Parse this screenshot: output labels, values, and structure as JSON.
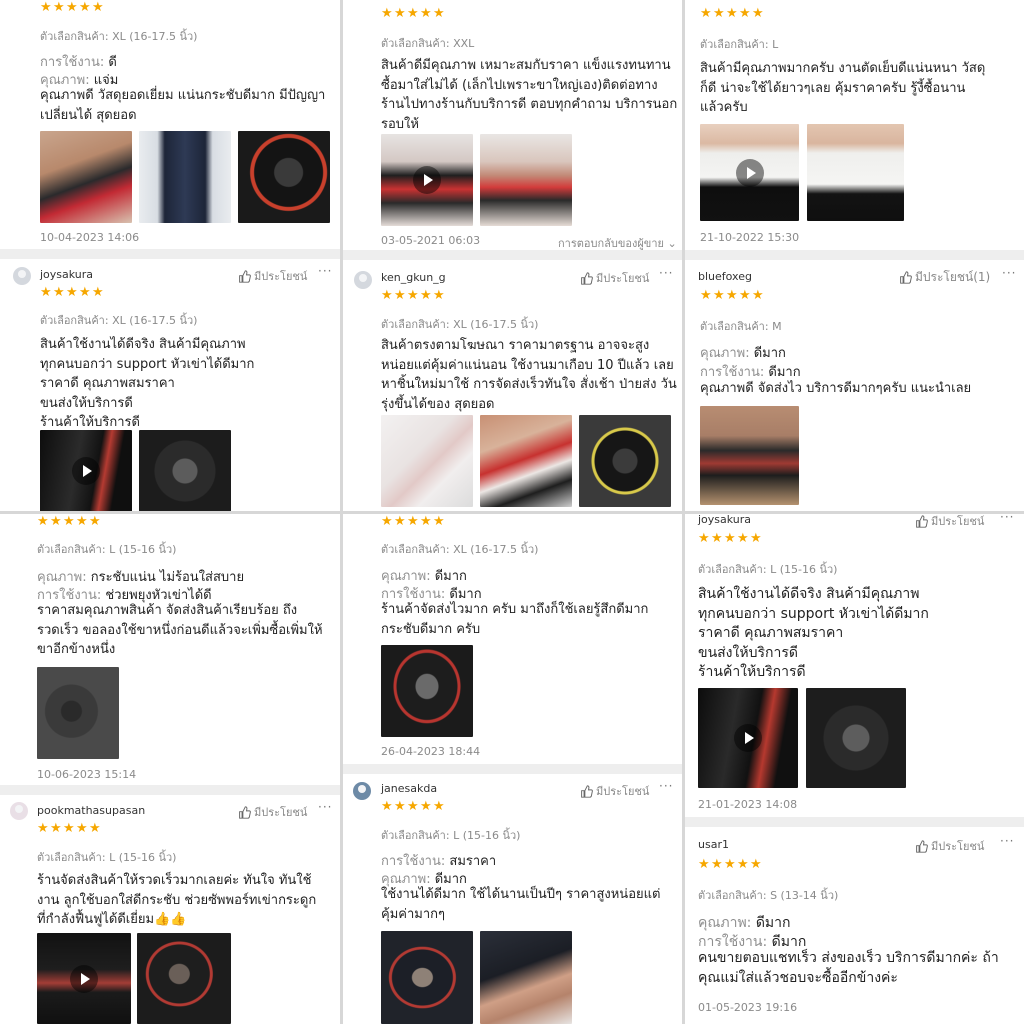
{
  "labels": {
    "variant_prefix": "ตัวเลือกสินค้า:",
    "usage": "การใช้งาน:",
    "quality": "คุณภาพ:",
    "helpful": "มีประโยชน์",
    "helpful_count": "มีประโยชน์(1)",
    "seller_reply": "การตอบกลับของผู้ขาย"
  },
  "colors": {
    "star": "#f6a700",
    "divider": "#d7d7d7",
    "section_gap": "#eeeeee"
  },
  "reviews": {
    "p1a": {
      "variant": "XL (16-17.5 นิ้ว)",
      "usage_val": "ดี",
      "quality_val": "แจ่ม",
      "lines": [
        "คุณภาพดี วัสดุยอดเยี่ยม แน่นกระชับดีมาก มีปัญญา",
        "เปลี่ยนได้ สุดยอด"
      ],
      "date": "10-04-2023 14:06"
    },
    "p1b": {
      "user": "joysakura",
      "variant": "XL (16-17.5 นิ้ว)",
      "lines": [
        "สินค้าใช้งานได้ดีจริง สินค้ามีคุณภาพ",
        "ทุกคนบอกว่า support หัวเข่าได้ดีมาก",
        "ราคาดี คุณภาพสมราคา",
        "ขนส่งให้บริการดี",
        "ร้านค้าให้บริการดี"
      ]
    },
    "p2a": {
      "variant": "XXL",
      "lines": [
        "สินค้าดีมีคุณภาพ เหมาะสมกับราคา แข็งแรงทนทาน",
        "ซื้อมาใส่ไม่ได้ (เล็กไปเพราะขาใหญ่เอง)ติดต่อทาง",
        "ร้านไปทางร้านกับบริการดี ตอบทุกคำถาม บริการนอก",
        "รอบให้"
      ],
      "date": "03-05-2021 06:03"
    },
    "p2b": {
      "user": "ken_gkun_g",
      "variant": "XL (16-17.5 นิ้ว)",
      "lines": [
        "สินค้าตรงตามโฆษณา ราคามาตรฐาน อาจจะสูง",
        "หน่อยแต่คุ้มค่าแน่นอน ใช้งานมาเกือบ 10 ปีแล้ว เลย",
        "หาชิ้นใหม่มาใช้ การจัดส่งเร็วทันใจ สั่งเช้า ป่ายส่ง วัน",
        "รุ่งขึ้นได้ของ สุดยอด"
      ]
    },
    "p3a": {
      "variant": "L",
      "lines": [
        "สินค้ามีคุณภาพมากครับ งานตัดเย็บดีแน่นหนา วัสดุ",
        "ก็ดี น่าจะใช้ได้ยาวๆเลย คุ้มราคาครับ รู้งี้ซื้อนาน",
        "แล้วครับ"
      ],
      "date": "21-10-2022 15:30"
    },
    "p3b": {
      "user": "bluefoxeg",
      "variant": "M",
      "quality_val": "ดีมาก",
      "usage_val": "ดีมาก",
      "lines": [
        "คุณภาพดี จัดส่งไว บริการดีมากๆครับ แนะนำเลย"
      ]
    },
    "p4a": {
      "variant": "L (15-16 นิ้ว)",
      "quality_val": "กระชับแน่น ไม่ร้อนใส่สบาย",
      "usage_val": "ช่วยพยุงหัวเข่าได้ดี",
      "lines": [
        "ราคาสมคุณภาพสินค้า จัดส่งสินค้าเรียบร้อย ถึง",
        "รวดเร็ว ขอลองใช้ขาหนึ่งก่อนดีแล้วจะเพิ่มซื้อเพิ่มให้",
        "ขาอีกข้างหนึ่ง"
      ],
      "date": "10-06-2023 15:14"
    },
    "p4b": {
      "user": "pookmathasupasan",
      "variant": "L (15-16 นิ้ว)",
      "lines": [
        "ร้านจัดส่งสินค้าให้รวดเร็วมากเลยค่ะ ทันใจ ทันใช้",
        "งาน ลูกใช้บอกใส่ดีกระชับ ช่วยซัพพอร์ทเข่ากระดูก",
        "ที่กำลังฟื้นฟูได้ดีเยี่ยม👍👍"
      ]
    },
    "p5a": {
      "variant": "XL (16-17.5 นิ้ว)",
      "quality_val": "ดีมาก",
      "usage_val": "ดีมาก",
      "lines": [
        "ร้านค้าจัดส่งไวมาก ครับ มาถึงก็ใช้เลยรู้สึกดีมาก",
        "กระชับดีมาก ครับ"
      ],
      "date": "26-04-2023 18:44"
    },
    "p5b": {
      "user": "janesakda",
      "variant": "L (15-16 นิ้ว)",
      "usage_val": "สมราคา",
      "quality_val": "ดีมาก",
      "lines": [
        "ใช้งานได้ดีมาก ใช้ได้นานเป็นปีๆ ราคาสูงหน่อยแต่",
        "คุ้มค่ามากๆ"
      ]
    },
    "p6a": {
      "user": "joysakura",
      "variant": "L (15-16 นิ้ว)",
      "lines": [
        "สินค้าใช้งานได้ดีจริง สินค้ามีคุณภาพ",
        "ทุกคนบอกว่า support หัวเข่าได้ดีมาก",
        "ราคาดี คุณภาพสมราคา",
        "ขนส่งให้บริการดี",
        "ร้านค้าให้บริการดี"
      ],
      "date": "21-01-2023 14:08"
    },
    "p6b": {
      "user": "usar1",
      "variant": "S (13-14 นิ้ว)",
      "quality_val": "ดีมาก",
      "usage_val": "ดีมาก",
      "lines": [
        "คนขายตอบแชทเร็ว ส่งของเร็ว บริการดีมากค่ะ ถ้า",
        "คุณแม่ใส่แล้วชอบจะซื้ออีกข้างค่ะ"
      ],
      "date": "01-05-2023 19:16"
    }
  }
}
